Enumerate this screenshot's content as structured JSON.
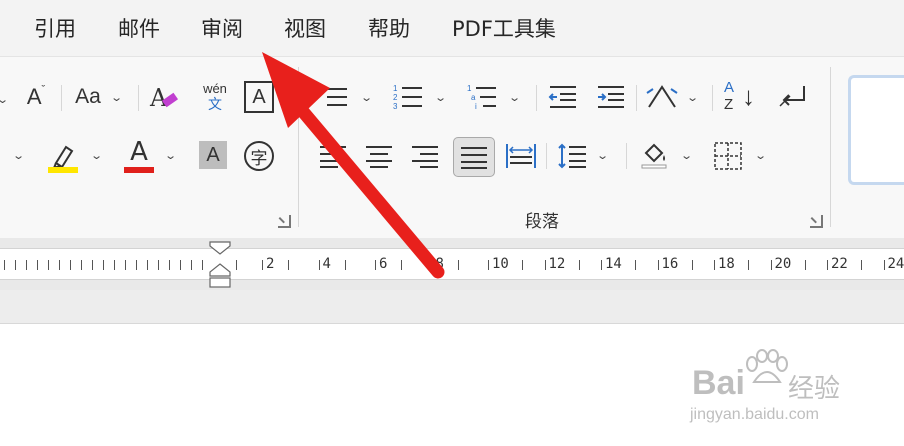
{
  "menu": {
    "items": [
      "引用",
      "邮件",
      "审阅",
      "视图",
      "帮助",
      "PDF工具集"
    ]
  },
  "font_group": {
    "grow_label": "A",
    "case_label": "Aa",
    "pinyin_top": "wén",
    "pinyin_bottom": "文",
    "border_label": "A",
    "font_color_label": "A",
    "shade_label": "A",
    "enclose_label": "字",
    "highlight_color": "#ffe600",
    "font_color": "#e0201b"
  },
  "paragraph_group": {
    "label": "段落",
    "sort_az": "A",
    "sort_z": "Z"
  },
  "ruler": {
    "numbers": [
      "2",
      "4",
      "6",
      "8",
      "10",
      "12",
      "14",
      "16",
      "18",
      "20",
      "22",
      "24"
    ]
  },
  "watermark": {
    "brand": "Bai",
    "brand_suffix": "经验",
    "url": "jingyan.baidu.com"
  },
  "colors": {
    "arrow": "#e8201c",
    "accent": "#2b6fc6"
  }
}
